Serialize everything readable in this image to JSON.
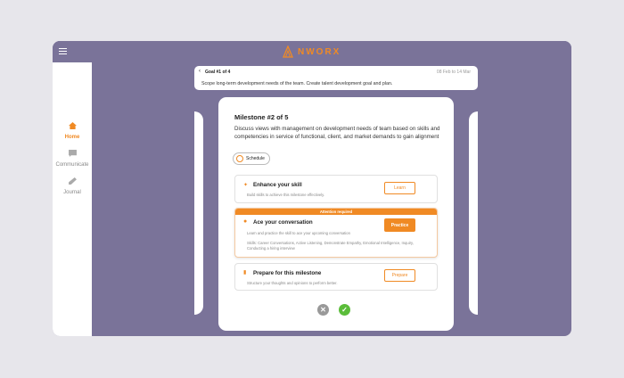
{
  "brand": {
    "name": "NWORX",
    "accent": "#f08a24",
    "frame_color": "#7a7399"
  },
  "nav": [
    {
      "label": "Home",
      "icon": "home-icon",
      "active": true
    },
    {
      "label": "Communicate",
      "icon": "chat-icon",
      "active": false
    },
    {
      "label": "Journal",
      "icon": "pencil-icon",
      "active": false
    }
  ],
  "goal": {
    "title": "Goal #1 of 4",
    "dates": "08 Feb to 14 Mar",
    "description": "Scope long-term development needs of the team. Create talent development goal and plan."
  },
  "milestone": {
    "title": "Milestone #2 of 5",
    "description": "Discuss views with management on development needs of team based on skills and competencies in service of functional, client, and market demands to gain alignment",
    "schedule_label": "Schedule",
    "items": [
      {
        "title": "Enhance your skill",
        "subtitle": "Build skills to achieve this milestone effectively.",
        "button": "Learn"
      },
      {
        "banner": "Attention required",
        "title": "Ace your conversation",
        "subtitle": "Learn and practice the skill to ace your upcoming conversation",
        "skills": "Skills: Career Conversations, Active Listening, Demonstrate Empathy, Emotional Intelligence, Inquiry, Conducting a hiring interview",
        "button": "Practice"
      },
      {
        "title": "Prepare for this milestone",
        "subtitle": "Structure your thoughts and opinions to perform better.",
        "button": "Prepare"
      }
    ]
  }
}
